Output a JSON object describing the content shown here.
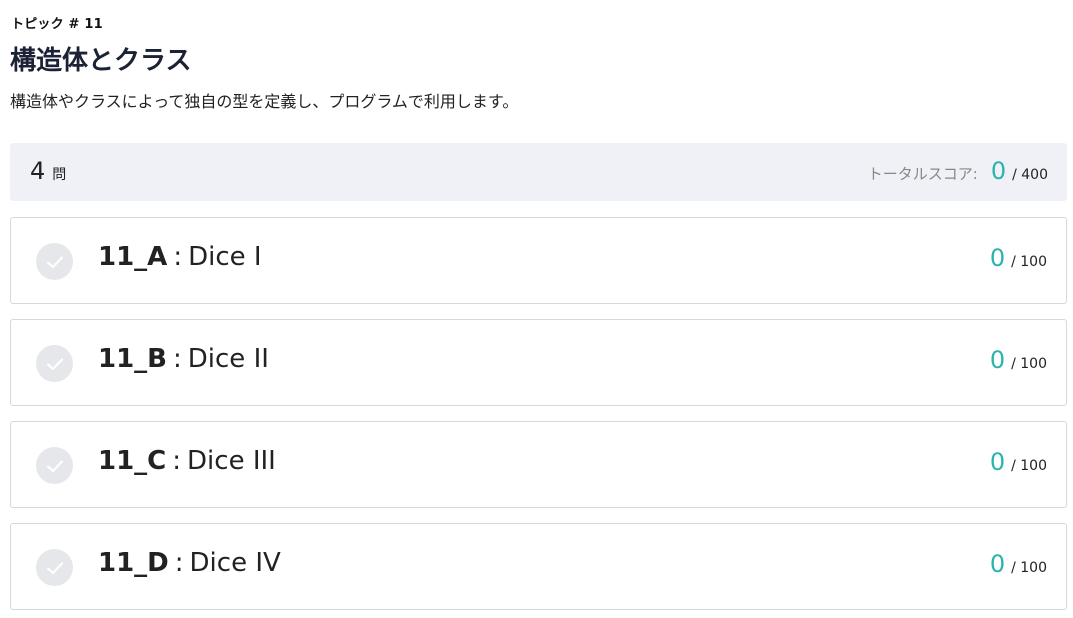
{
  "topic": {
    "label": "トピック # 11",
    "title": "構造体とクラス",
    "description": "構造体やクラスによって独自の型を定義し、プログラムで利用します。"
  },
  "summary": {
    "count": "4",
    "count_unit": "問",
    "score_label": "トータルスコア:",
    "score": "0",
    "score_max": "/ 400"
  },
  "colors": {
    "accent": "#2bb3ad",
    "check_bg": "#e6e7eb",
    "summary_bg": "#f0f1f6"
  },
  "problems": [
    {
      "id": "11_A",
      "separator": ":",
      "name": "Dice I",
      "score": "0",
      "max": "/ 100",
      "icon": "check-icon"
    },
    {
      "id": "11_B",
      "separator": ":",
      "name": "Dice II",
      "score": "0",
      "max": "/ 100",
      "icon": "check-icon"
    },
    {
      "id": "11_C",
      "separator": ":",
      "name": "Dice III",
      "score": "0",
      "max": "/ 100",
      "icon": "check-icon"
    },
    {
      "id": "11_D",
      "separator": ":",
      "name": "Dice IV",
      "score": "0",
      "max": "/ 100",
      "icon": "check-icon"
    }
  ]
}
